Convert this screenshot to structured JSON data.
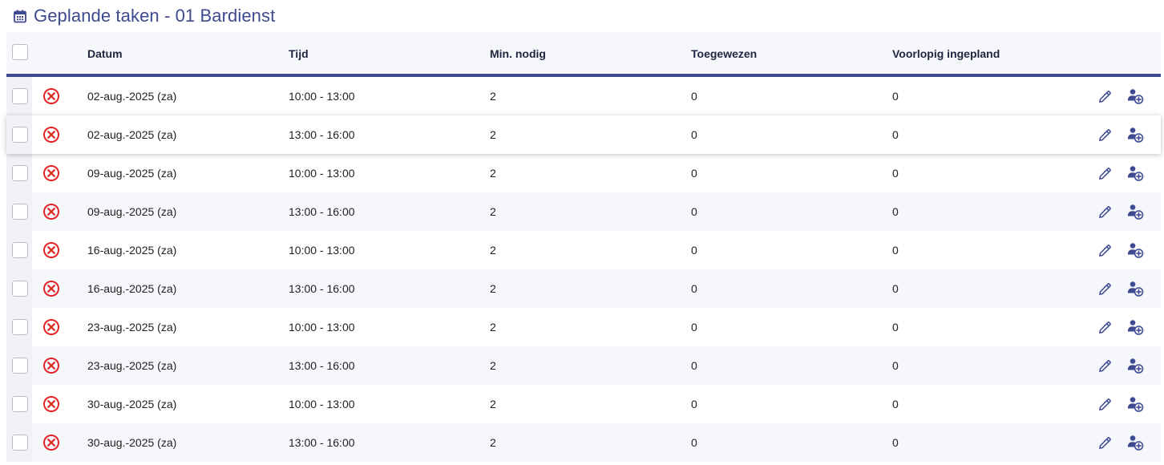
{
  "header": {
    "title": "Geplande taken - 01 Bardienst",
    "icon": "calendar-icon"
  },
  "colors": {
    "accent": "#3d4a8f",
    "danger": "#e02424",
    "row_alt": "#f6f7fb"
  },
  "table": {
    "columns": [
      "Datum",
      "Tijd",
      "Min. nodig",
      "Toegewezen",
      "Voorlopig ingepland"
    ],
    "rows": [
      {
        "datum": "02-aug.-2025 (za)",
        "tijd": "10:00 - 13:00",
        "min": "2",
        "toegewezen": "0",
        "voorlopig": "0"
      },
      {
        "datum": "02-aug.-2025 (za)",
        "tijd": "13:00 - 16:00",
        "min": "2",
        "toegewezen": "0",
        "voorlopig": "0"
      },
      {
        "datum": "09-aug.-2025 (za)",
        "tijd": "10:00 - 13:00",
        "min": "2",
        "toegewezen": "0",
        "voorlopig": "0"
      },
      {
        "datum": "09-aug.-2025 (za)",
        "tijd": "13:00 - 16:00",
        "min": "2",
        "toegewezen": "0",
        "voorlopig": "0"
      },
      {
        "datum": "16-aug.-2025 (za)",
        "tijd": "10:00 - 13:00",
        "min": "2",
        "toegewezen": "0",
        "voorlopig": "0"
      },
      {
        "datum": "16-aug.-2025 (za)",
        "tijd": "13:00 - 16:00",
        "min": "2",
        "toegewezen": "0",
        "voorlopig": "0"
      },
      {
        "datum": "23-aug.-2025 (za)",
        "tijd": "10:00 - 13:00",
        "min": "2",
        "toegewezen": "0",
        "voorlopig": "0"
      },
      {
        "datum": "23-aug.-2025 (za)",
        "tijd": "13:00 - 16:00",
        "min": "2",
        "toegewezen": "0",
        "voorlopig": "0"
      },
      {
        "datum": "30-aug.-2025 (za)",
        "tijd": "10:00 - 13:00",
        "min": "2",
        "toegewezen": "0",
        "voorlopig": "0"
      },
      {
        "datum": "30-aug.-2025 (za)",
        "tijd": "13:00 - 16:00",
        "min": "2",
        "toegewezen": "0",
        "voorlopig": "0"
      }
    ]
  }
}
